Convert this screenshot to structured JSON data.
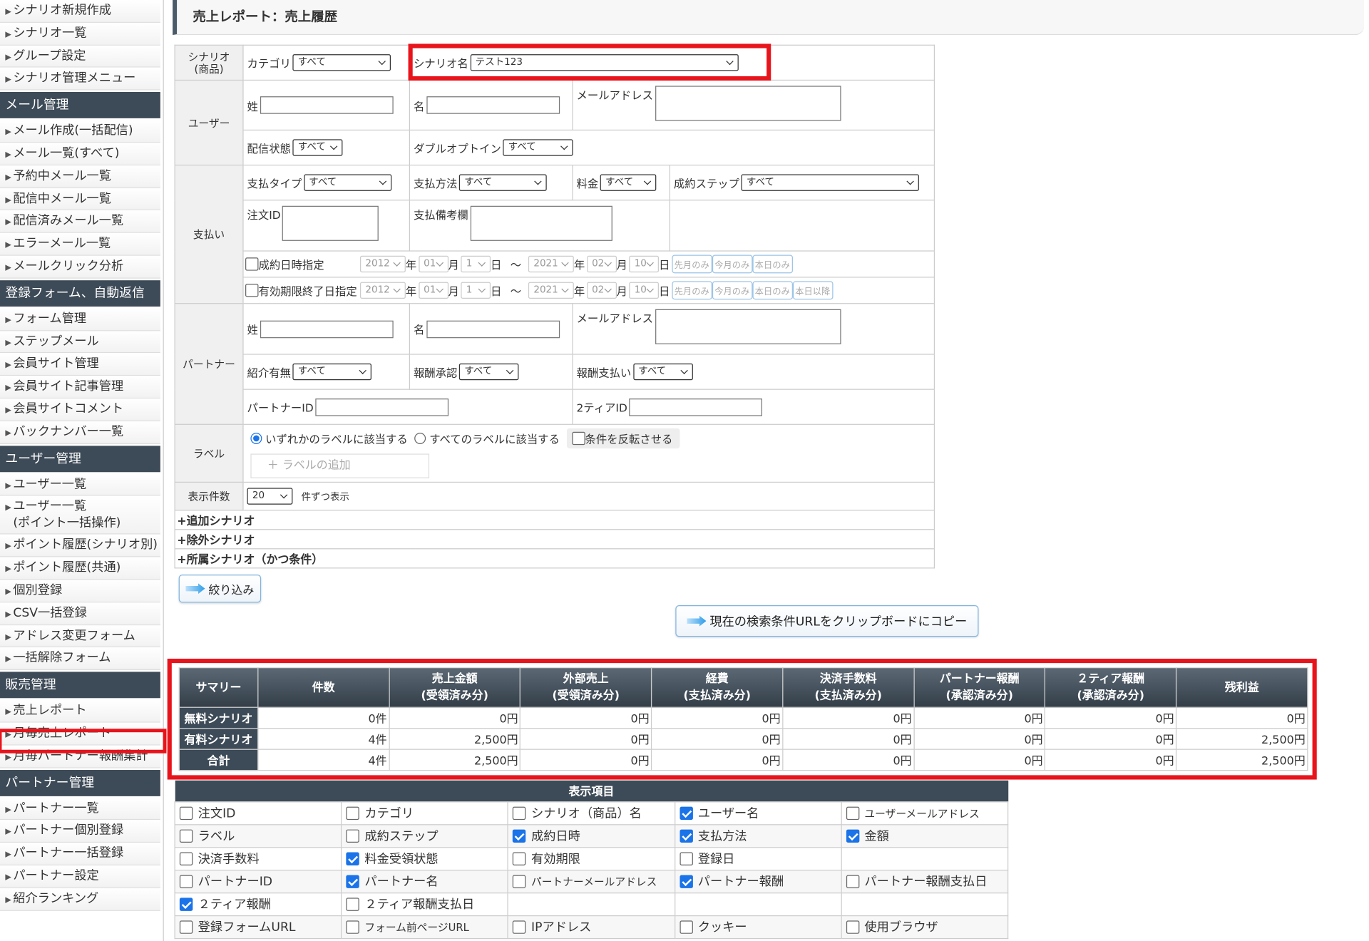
{
  "sidebar": {
    "items_top": [
      "シナリオ新規作成",
      "シナリオ一覧",
      "グループ設定",
      "シナリオ管理メニュー"
    ],
    "mail": {
      "header": "メール管理",
      "items": [
        "メール作成(一括配信)",
        "メール一覧(すべて)",
        "予約中メール一覧",
        "配信中メール一覧",
        "配信済みメール一覧",
        "エラーメール一覧",
        "メールクリック分析"
      ]
    },
    "form": {
      "header": "登録フォーム、自動返信",
      "items": [
        "フォーム管理",
        "ステップメール",
        "会員サイト管理",
        "会員サイト記事管理",
        "会員サイトコメント",
        "バックナンバー一覧"
      ]
    },
    "user": {
      "header": "ユーザー管理",
      "items": [
        "ユーザー一覧",
        "ユーザー一覧\n(ポイント一括操作)",
        "ポイント履歴(シナリオ別)",
        "ポイント履歴(共通)",
        "個別登録",
        "CSV一括登録",
        "アドレス変更フォーム",
        "一括解除フォーム"
      ]
    },
    "sales": {
      "header": "販売管理",
      "items": [
        "売上レポート",
        "月毎売上レポート",
        "月毎パートナー報酬集計"
      ]
    },
    "partner": {
      "header": "パートナー管理",
      "items": [
        "パートナー一覧",
        "パートナー個別登録",
        "パートナー一括登録",
        "パートナー設定",
        "紹介ランキング"
      ]
    }
  },
  "page_title": "売上レポート：売上履歴",
  "filter": {
    "scenario_header": "シナリオ\n(商品)",
    "category_label": "カテゴリ",
    "category_value": "すべて",
    "scenario_name_label": "シナリオ名",
    "scenario_name_value": "テスト123",
    "user_header": "ユーザー",
    "last_name": "姓",
    "first_name": "名",
    "email": "メールアドレス",
    "delivery_label": "配信状態",
    "delivery_value": "すべて",
    "double_optin_label": "ダブルオプトイン",
    "double_optin_value": "すべて",
    "payment_header": "支払い",
    "pay_type_label": "支払タイプ",
    "pay_type_value": "すべて",
    "pay_method_label": "支払方法",
    "pay_method_value": "すべて",
    "fee_label": "料金",
    "fee_value": "すべて",
    "step_label": "成約ステップ",
    "step_value": "すべて",
    "order_id_label": "注文ID",
    "pay_note_label": "支払備考欄",
    "contract_date_label": "成約日時指定",
    "expire_date_label": "有効期限終了日指定",
    "from_year": "2012",
    "from_month": "01",
    "from_day": "1",
    "to_year": "2021",
    "to_month": "02",
    "to_day": "10",
    "u_year": "年",
    "u_month": "月",
    "u_day": "日",
    "tilde": "～",
    "btn_last_month": "先月のみ",
    "btn_this_month": "今月のみ",
    "btn_today": "本日のみ",
    "btn_after_today": "本日以降",
    "partner_header": "パートナー",
    "referral_label": "紹介有無",
    "referral_value": "すべて",
    "reward_approve_label": "報酬承認",
    "reward_approve_value": "すべて",
    "reward_pay_label": "報酬支払い",
    "reward_pay_value": "すべて",
    "partner_id_label": "パートナーID",
    "tier2_id_label": "2ティアID",
    "label_header": "ラベル",
    "label_any": "いずれかのラベルに該当する",
    "label_all": "すべてのラベルに該当する",
    "label_invert": "条件を反転させる",
    "label_add": "＋ ラベルの追加",
    "count_header": "表示件数",
    "count_value": "20",
    "count_suffix": "件ずつ表示",
    "add_scenario": "+追加シナリオ",
    "exclude_scenario": "+除外シナリオ",
    "belong_scenario": "+所属シナリオ（かつ条件）"
  },
  "buttons": {
    "filter": "絞り込み",
    "copy_url": "現在の検索条件URLをクリップボードにコピー"
  },
  "summary": {
    "headers": [
      "サマリー",
      "件数",
      "売上金額\n(受領済み分)",
      "外部売上\n(受領済み分)",
      "経費\n(支払済み分)",
      "決済手数料\n(支払済み分)",
      "パートナー報酬\n(承認済み分)",
      "２ティア報酬\n(承認済み分)",
      "残利益"
    ],
    "rows": [
      {
        "label": "無料シナリオ",
        "values": [
          "0件",
          "0円",
          "0円",
          "0円",
          "0円",
          "0円",
          "0円",
          "0円"
        ]
      },
      {
        "label": "有料シナリオ",
        "values": [
          "4件",
          "2,500円",
          "0円",
          "0円",
          "0円",
          "0円",
          "0円",
          "2,500円"
        ]
      },
      {
        "label": "合計",
        "values": [
          "4件",
          "2,500円",
          "0円",
          "0円",
          "0円",
          "0円",
          "0円",
          "2,500円"
        ]
      }
    ]
  },
  "display": {
    "header": "表示項目",
    "rows": [
      [
        {
          "label": "注文ID",
          "checked": false
        },
        {
          "label": "カテゴリ",
          "checked": false
        },
        {
          "label": "シナリオ（商品）名",
          "checked": false
        },
        {
          "label": "ユーザー名",
          "checked": true
        },
        {
          "label": "ユーザーメールアドレス",
          "checked": false
        }
      ],
      [
        {
          "label": "ラベル",
          "checked": false
        },
        {
          "label": "成約ステップ",
          "checked": false
        },
        {
          "label": "成約日時",
          "checked": true
        },
        {
          "label": "支払方法",
          "checked": true
        },
        {
          "label": "金額",
          "checked": true
        }
      ],
      [
        {
          "label": "決済手数料",
          "checked": false
        },
        {
          "label": "料金受領状態",
          "checked": true
        },
        {
          "label": "有効期限",
          "checked": false
        },
        {
          "label": "登録日",
          "checked": false
        },
        null
      ],
      [
        {
          "label": "パートナーID",
          "checked": false
        },
        {
          "label": "パートナー名",
          "checked": true
        },
        {
          "label": "パートナーメールアドレス",
          "checked": false
        },
        {
          "label": "パートナー報酬",
          "checked": true
        },
        {
          "label": "パートナー報酬支払日",
          "checked": false
        }
      ],
      [
        {
          "label": "２ティア報酬",
          "checked": true
        },
        {
          "label": "２ティア報酬支払日",
          "checked": false
        },
        null,
        null,
        null
      ],
      [
        {
          "label": "登録フォームURL",
          "checked": false
        },
        {
          "label": "フォーム前ページURL",
          "checked": false
        },
        {
          "label": "IPアドレス",
          "checked": false
        },
        {
          "label": "クッキー",
          "checked": false
        },
        {
          "label": "使用ブラウザ",
          "checked": false
        }
      ]
    ]
  },
  "colors": {
    "highlight": "#e8141c",
    "header_dark": "#3d4a57",
    "check_blue": "#1a73e8"
  }
}
